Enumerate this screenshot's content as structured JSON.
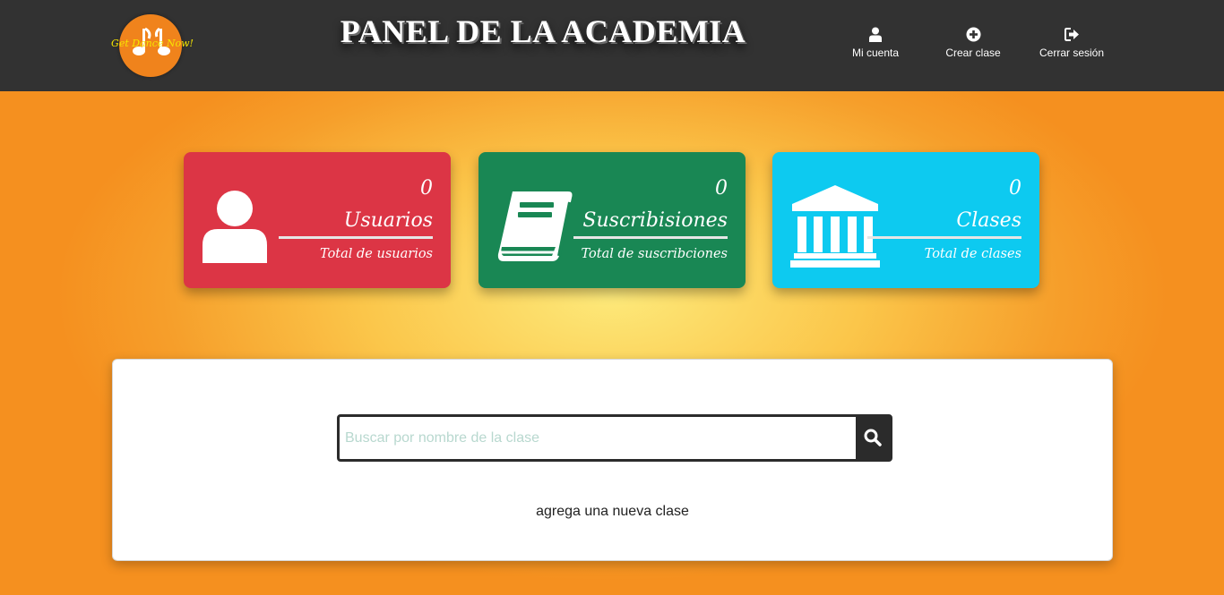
{
  "header": {
    "logo_text": "Get Dance Now!",
    "title": "PANEL DE LA ACADEMIA",
    "nav": [
      {
        "label": "Mi cuenta",
        "icon": "user-icon"
      },
      {
        "label": "Crear clase",
        "icon": "plus-circle-icon"
      },
      {
        "label": "Cerrar sesión",
        "icon": "sign-out-icon"
      }
    ]
  },
  "stats": [
    {
      "count": "0",
      "label": "Usuarios",
      "sub": "Total de usuarios",
      "color": "#dc3545",
      "icon": "user-icon"
    },
    {
      "count": "0",
      "label": "Suscribisiones",
      "sub": "Total de suscribciones",
      "color": "#198754",
      "icon": "book-icon"
    },
    {
      "count": "0",
      "label": "Clases",
      "sub": "Total de clases",
      "color": "#0dcaf0",
      "icon": "university-icon"
    }
  ],
  "search": {
    "placeholder": "Buscar por nombre de la clase",
    "value": "",
    "button_icon": "search-icon"
  },
  "add_class_text": "agrega una nueva clase"
}
